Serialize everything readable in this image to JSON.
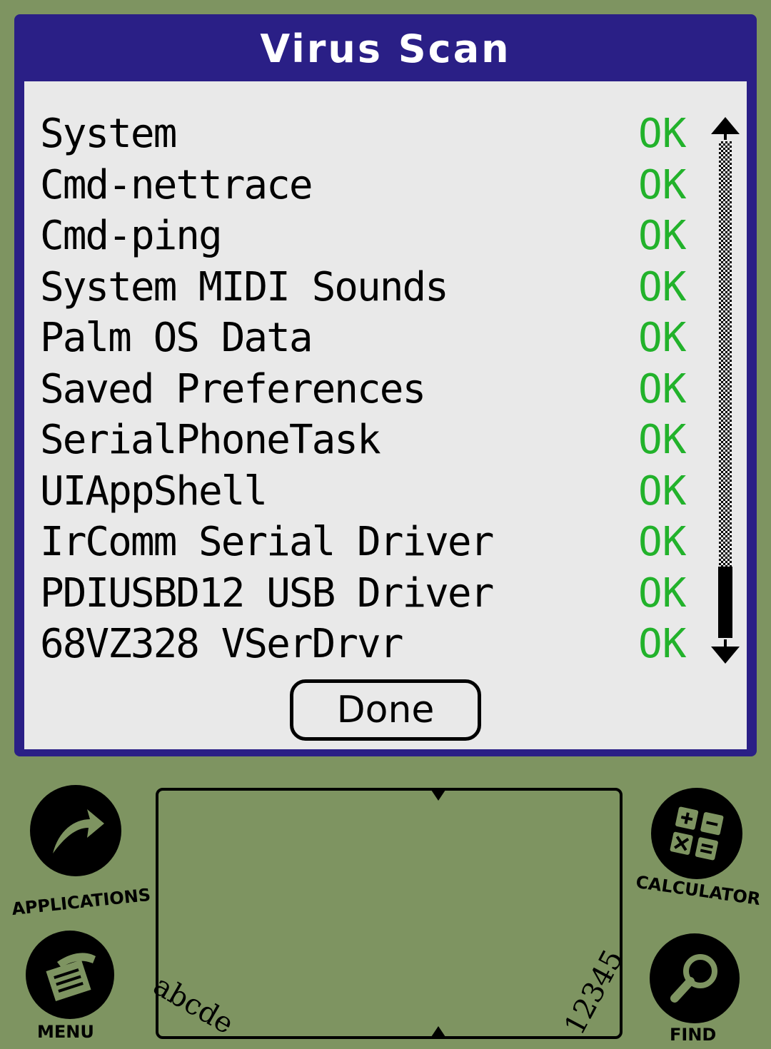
{
  "dialog": {
    "title": "Virus Scan",
    "done_label": "Done"
  },
  "colors": {
    "title_bar": "#2a1f86",
    "status_ok": "#22b22b",
    "background": "#7e9461"
  },
  "scan_results": [
    {
      "name": "System",
      "status": "OK"
    },
    {
      "name": "Cmd-nettrace",
      "status": "OK"
    },
    {
      "name": "Cmd-ping",
      "status": "OK"
    },
    {
      "name": "System MIDI Sounds",
      "status": "OK"
    },
    {
      "name": "Palm OS Data",
      "status": "OK"
    },
    {
      "name": "Saved Preferences",
      "status": "OK"
    },
    {
      "name": "SerialPhoneTask",
      "status": "OK"
    },
    {
      "name": "UIAppShell",
      "status": "OK"
    },
    {
      "name": "IrComm Serial Driver",
      "status": "OK"
    },
    {
      "name": "PDIUSBD12 USB Driver",
      "status": "OK"
    },
    {
      "name": "68VZ328 VSerDrvr",
      "status": "OK"
    }
  ],
  "silkscreen": {
    "applications_label": "APPLICATIONS",
    "menu_label": "MENU",
    "calculator_label": "CALCULATOR",
    "find_label": "FIND",
    "graffiti_letters": "abcde",
    "graffiti_numbers": "12345"
  }
}
